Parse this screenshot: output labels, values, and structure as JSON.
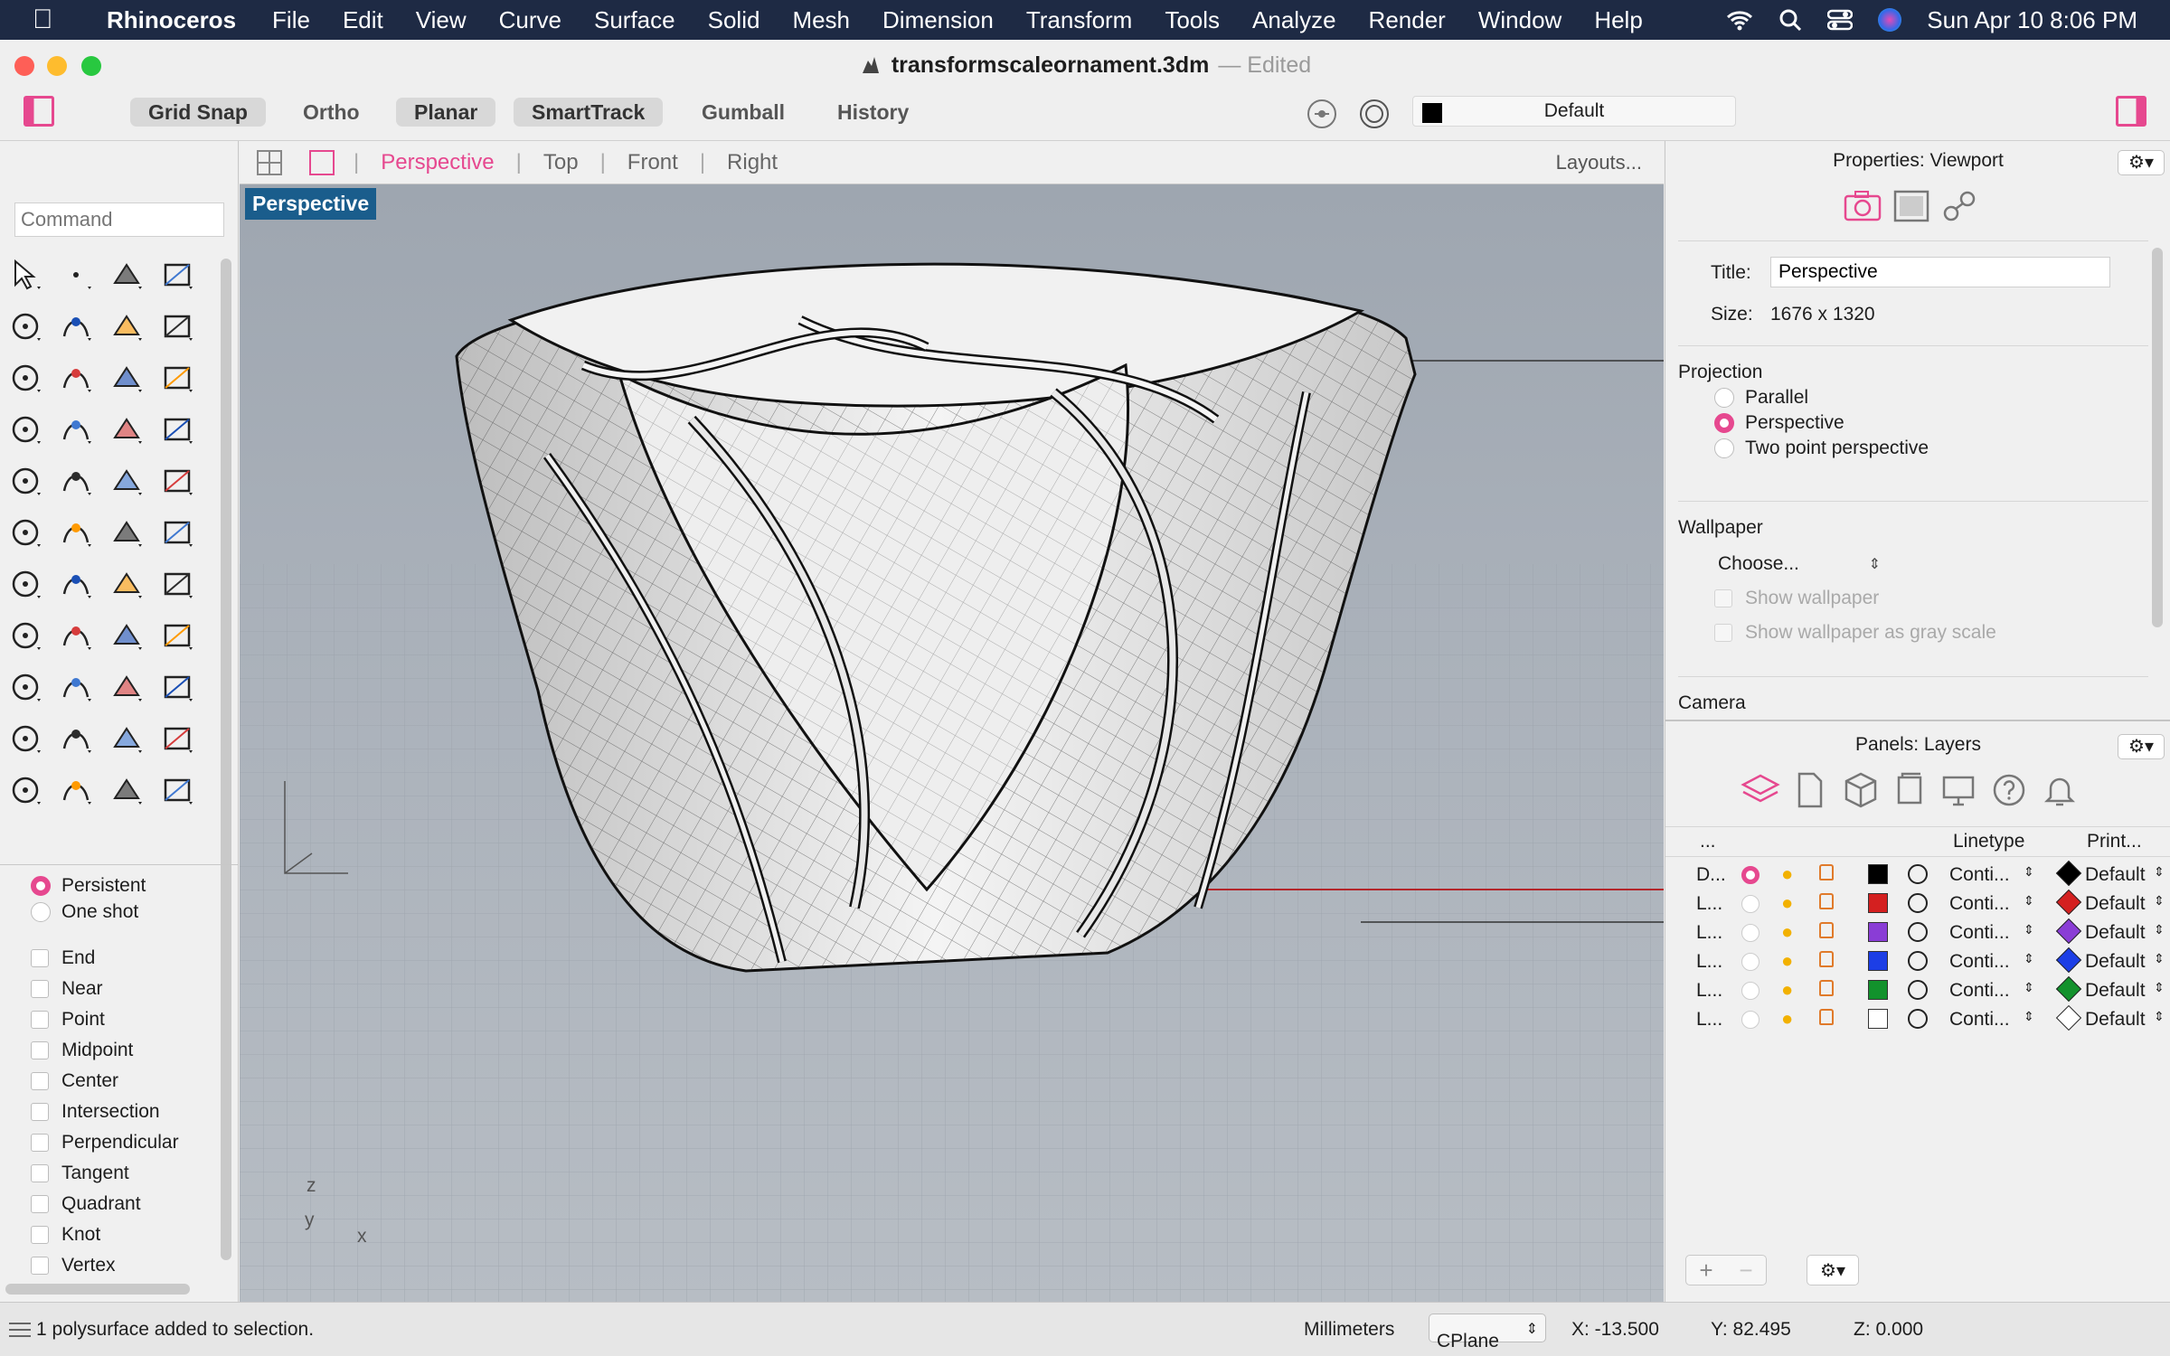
{
  "menubar": {
    "app": "Rhinoceros",
    "items": [
      "File",
      "Edit",
      "View",
      "Curve",
      "Surface",
      "Solid",
      "Mesh",
      "Dimension",
      "Transform",
      "Tools",
      "Analyze",
      "Render",
      "Window",
      "Help"
    ],
    "clock": "Sun Apr 10  8:06 PM"
  },
  "window": {
    "title": "transformscaleornament.3dm",
    "edited": "Edited"
  },
  "toolbar": {
    "toggles": [
      {
        "label": "Grid Snap",
        "on": true
      },
      {
        "label": "Ortho",
        "on": false
      },
      {
        "label": "Planar",
        "on": true
      },
      {
        "label": "SmartTrack",
        "on": true
      },
      {
        "label": "Gumball",
        "on": false
      },
      {
        "label": "History",
        "on": false
      }
    ],
    "layer": "Default"
  },
  "command": {
    "placeholder": "Command"
  },
  "viewport_tabs": {
    "tabs": [
      "Perspective",
      "Top",
      "Front",
      "Right"
    ],
    "active": "Perspective",
    "layouts": "Layouts..."
  },
  "viewport": {
    "name": "Perspective",
    "axes": {
      "z": "z",
      "y": "y",
      "x": "x"
    }
  },
  "osnap": {
    "modes": [
      "Persistent",
      "One shot"
    ],
    "active_mode": "Persistent",
    "items": [
      "End",
      "Near",
      "Point",
      "Midpoint",
      "Center",
      "Intersection",
      "Perpendicular",
      "Tangent",
      "Quadrant",
      "Knot",
      "Vertex"
    ]
  },
  "properties": {
    "header": "Properties: Viewport",
    "title_label": "Title:",
    "title_value": "Perspective",
    "size_label": "Size:",
    "size_value": "1676 x 1320",
    "projection_label": "Projection",
    "projection_options": [
      "Parallel",
      "Perspective",
      "Two point perspective"
    ],
    "projection_selected": "Perspective",
    "wallpaper_label": "Wallpaper",
    "wallpaper_choose": "Choose...",
    "wallpaper_checks": [
      "Show wallpaper",
      "Show wallpaper as gray scale"
    ],
    "camera_label": "Camera"
  },
  "layers": {
    "header": "Panels: Layers",
    "col_name": "...",
    "col_linetype": "Linetype",
    "col_print": "Print...",
    "rows": [
      {
        "name": "D...",
        "current": true,
        "color": "#000000",
        "linetype": "Conti...",
        "print": "Default"
      },
      {
        "name": "L...",
        "current": false,
        "color": "#d42020",
        "linetype": "Conti...",
        "print": "Default"
      },
      {
        "name": "L...",
        "current": false,
        "color": "#8a3dd6",
        "linetype": "Conti...",
        "print": "Default"
      },
      {
        "name": "L...",
        "current": false,
        "color": "#1c3ee6",
        "linetype": "Conti...",
        "print": "Default"
      },
      {
        "name": "L...",
        "current": false,
        "color": "#12922c",
        "linetype": "Conti...",
        "print": "Default"
      },
      {
        "name": "L...",
        "current": false,
        "color": "#ffffff",
        "linetype": "Conti...",
        "print": "Default"
      }
    ]
  },
  "status": {
    "message": "1 polysurface added to selection.",
    "units": "Millimeters",
    "cplane": "CPlane",
    "x": "X: -13.500",
    "y": "Y: 82.495",
    "z": "Z: 0.000"
  },
  "colors": {
    "accent": "#e6488f",
    "viewport_label_bg": "#1a5d8c"
  }
}
